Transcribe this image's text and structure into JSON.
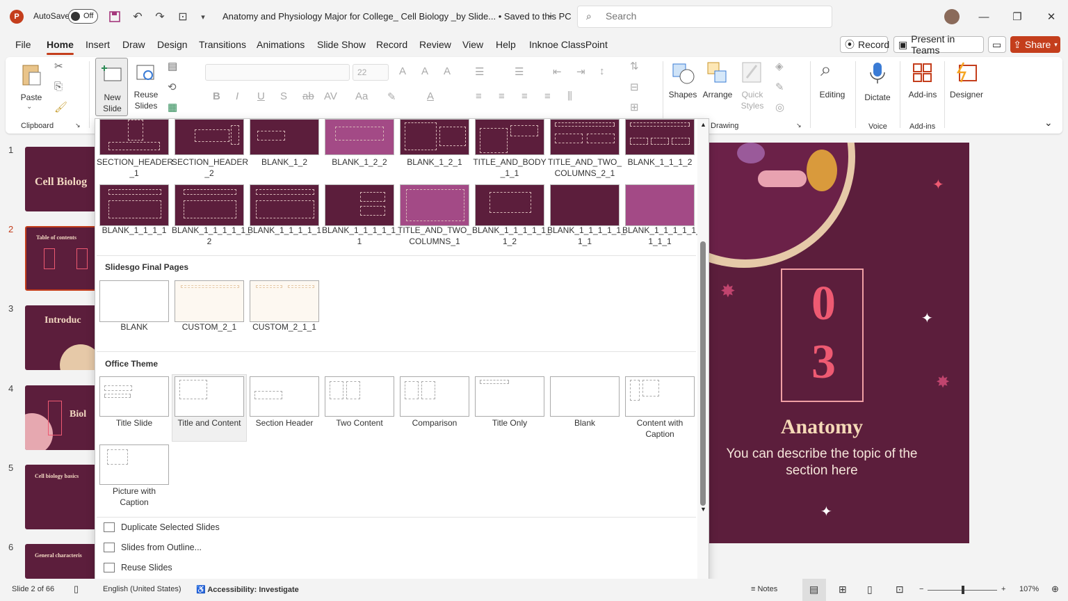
{
  "titlebar": {
    "app_icon": "P",
    "autosave_label": "AutoSave",
    "autosave_state": "Off",
    "title": "Anatomy and Physiology Major for College_ Cell Biology _by Slide... • Saved to this PC",
    "search_placeholder": "Search"
  },
  "menu": {
    "tabs": [
      "File",
      "Home",
      "Insert",
      "Draw",
      "Design",
      "Transitions",
      "Animations",
      "Slide Show",
      "Record",
      "Review",
      "View",
      "Help",
      "Inknoe ClassPoint"
    ],
    "active": "Home",
    "record_label": "Record",
    "present_label": "Present in Teams",
    "share_label": "Share"
  },
  "ribbon": {
    "paste": "Paste",
    "clipboard": "Clipboard",
    "new_slide": "New",
    "new_slide_2": "Slide",
    "reuse": "Reuse",
    "reuse_2": "Slides",
    "font_size": "22",
    "shapes": "Shapes",
    "arrange": "Arrange",
    "quick": "Quick",
    "styles": "Styles",
    "drawing": "Drawing",
    "editing": "Editing",
    "dictate": "Dictate",
    "voice": "Voice",
    "addins": "Add-ins",
    "addins_group": "Add-ins",
    "designer": "Designer"
  },
  "thumbnails": [
    {
      "num": "1",
      "text": "Cell Biolog"
    },
    {
      "num": "2",
      "text": "Table of contents"
    },
    {
      "num": "3",
      "text": "Introduc"
    },
    {
      "num": "4",
      "text": "Biol"
    },
    {
      "num": "5",
      "text": "Cell biology basics"
    },
    {
      "num": "6",
      "text": "General characteris"
    }
  ],
  "gallery": {
    "row1": [
      "SECTION_HEADER\n_1",
      "SECTION_HEADER\n_2",
      "BLANK_1_2",
      "BLANK_1_2_2",
      "BLANK_1_2_1",
      "TITLE_AND_BODY\n_1_1",
      "TITLE_AND_TWO_\nCOLUMNS_2_1",
      "BLANK_1_1_1_2"
    ],
    "row2": [
      "BLANK_1_1_1_1",
      "BLANK_1_1_1_1_1_\n2",
      "BLANK_1_1_1_1_1",
      "BLANK_1_1_1_1_1_\n1",
      "TITLE_AND_TWO_\nCOLUMNS_1",
      "BLANK_1_1_1_1_1_\n1_2",
      "BLANK_1_1_1_1_1_\n1_1",
      "BLANK_1_1_1_1_1_\n1_1_1"
    ],
    "section_final": "Slidesgo Final Pages",
    "final": [
      "BLANK",
      "CUSTOM_2_1",
      "CUSTOM_2_1_1"
    ],
    "section_office": "Office Theme",
    "office": [
      "Title Slide",
      "Title and Content",
      "Section Header",
      "Two Content",
      "Comparison",
      "Title Only",
      "Blank",
      "Content with\nCaption",
      "Picture with\nCaption"
    ],
    "menu_items": [
      "Duplicate Selected Slides",
      "Slides from Outline...",
      "Reuse Slides"
    ]
  },
  "slide": {
    "num_0": "0",
    "num_3": "3",
    "title": "Anatomy",
    "description": "You can describe the topic of the section here"
  },
  "status": {
    "slide_info": "Slide 2 of 66",
    "language": "English (United States)",
    "accessibility": "Accessibility: Investigate",
    "notes": "Notes",
    "zoom": "107%"
  },
  "colors": {
    "accent": "#c43e1c",
    "slide_bg": "#5c1e3c",
    "slide_pink": "#ee5a72"
  }
}
